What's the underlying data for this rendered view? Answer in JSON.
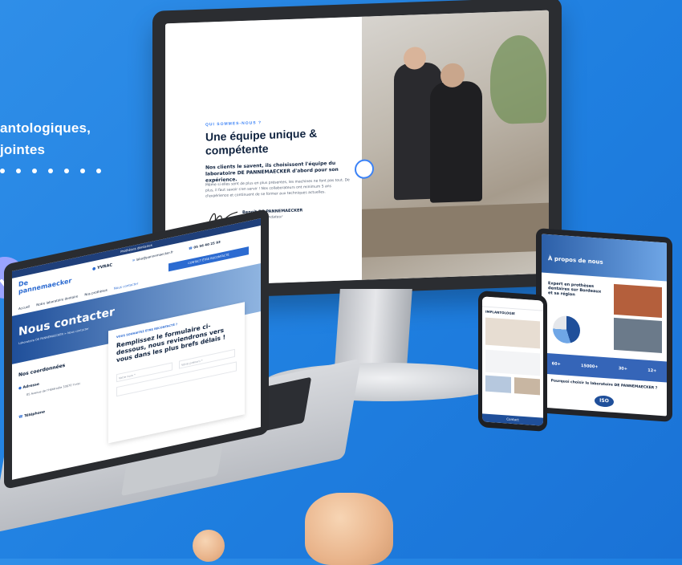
{
  "hero": {
    "line1": "antologiques,",
    "line2": "jointes"
  },
  "monitor": {
    "eyebrow": "QUI SOMMES-NOUS ?",
    "title": "Une équipe unique & compétente",
    "lead": "Nos clients le savent, ils choisissent l'équipe du laboratoire DE PANNEMAECKER d'abord pour son expérience.",
    "body": "Même si elles sont de plus en plus présentes, les machines ne font pas tout. De plus, il faut savoir s'en servir ! Nos collaborateurs ont minimum 5 ans d'expérience et continuent de se former aux techniques actuelles.",
    "signer_name": "Benoît DE PANNEMAECKER",
    "signer_role": "Dirigeant & Fondateur"
  },
  "laptop": {
    "topbar": "Prothèses dentaires",
    "brand_line1": "De",
    "brand_line2": "pannemaecker",
    "location_label": "YVRAC",
    "address_short": "85 Avenue de l'Hétérodie",
    "email": "labo@pannemaecker.fr",
    "phone": "05 56 40 25 93",
    "cta": "CONTACT ÊTRE RECONTACTÉ",
    "nav": [
      "Accueil",
      "Notre laboratoire dentaire",
      "Nos prothèses",
      "Nous contacter"
    ],
    "page_title": "Nous contacter",
    "breadcrumb": "Laboratoire DE PANNEMAECKER > Nous contacter",
    "form_eyebrow": "VOUS SOUHAITEZ ÊTRE RECONTACTÉ ?",
    "form_title": "Remplissez le formulaire ci-dessous, nous reviendrons vers vous dans les plus brefs délais !",
    "coords_title": "Nos coordonnées",
    "address_label": "Adresse",
    "address_value": "85 Avenue de l'Hétérodie 33670 Yvrac",
    "phone_label": "Téléphone",
    "field_name": "Votre nom *",
    "field_firstname": "Votre prénom *"
  },
  "tablet": {
    "page_title": "À propos de nous",
    "section_title": "Expert en prothèses dentaires sur Bordeaux et sa région",
    "stats": [
      "60+",
      "15000+",
      "30+",
      "12+"
    ],
    "why_title": "Pourquoi choisir le laboratoire DE PANNEMAECKER ?",
    "badge": "ISO"
  },
  "phone": {
    "heading": "IMPLANTOLOGIE",
    "cta": "Contact"
  },
  "colors": {
    "background": "#1f7fe0",
    "accent": "#3b82f6",
    "navy": "#10233f",
    "cursor": "#8e98ff"
  },
  "icons": [
    "search-icon",
    "cursor-arrow-icon",
    "location-pin-icon",
    "mail-icon",
    "phone-icon",
    "quote-icon"
  ]
}
